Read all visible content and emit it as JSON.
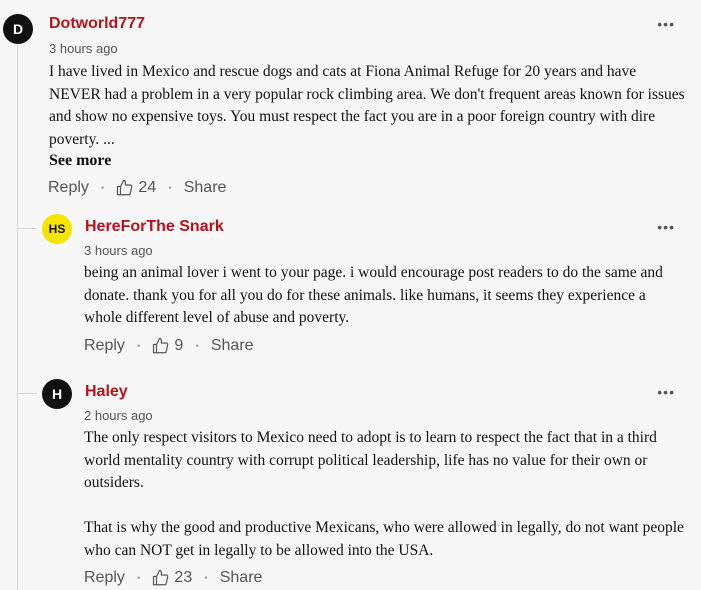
{
  "comments": [
    {
      "avatar": "D",
      "username": "Dotworld777",
      "time": "3 hours ago",
      "text": "I have lived in Mexico and rescue dogs and cats at Fiona Animal Refuge for 20 years and have NEVER had a problem in a very popular rock climbing area. We don't frequent areas known for issues and show no expensive toys. You must respect the fact you are in a poor foreign country with dire poverty. ...",
      "see_more": "See more",
      "reply_label": "Reply",
      "likes": "24",
      "share_label": "Share",
      "more_label": "•••"
    },
    {
      "avatar": "HS",
      "username": "HereForThe Snark",
      "time": "3 hours ago",
      "text": "being an animal lover i went to your page. i would encourage post readers to do the same and donate. thank you for all you do for these animals. like humans, it seems they experience a whole different level of abuse and poverty.",
      "reply_label": "Reply",
      "likes": "9",
      "share_label": "Share",
      "more_label": "•••"
    },
    {
      "avatar": "H",
      "username": "Haley",
      "time": "2 hours ago",
      "text": "The only respect visitors to Mexico need to adopt is to learn to  respect the fact that in a third world mentality country with corrupt political leadership, life has no value for their own or outsiders.\n\nThat is why the good and productive Mexicans, who were allowed in legally, do not want people who can NOT get in legally to be allowed into the USA.",
      "reply_label": "Reply",
      "likes": "23",
      "share_label": "Share",
      "more_label": "•••"
    }
  ],
  "colors": {
    "username": "#b8121a",
    "avatar_dark": "#111111",
    "avatar_yellow": "#f5e400",
    "background": "#f7f7f7"
  }
}
